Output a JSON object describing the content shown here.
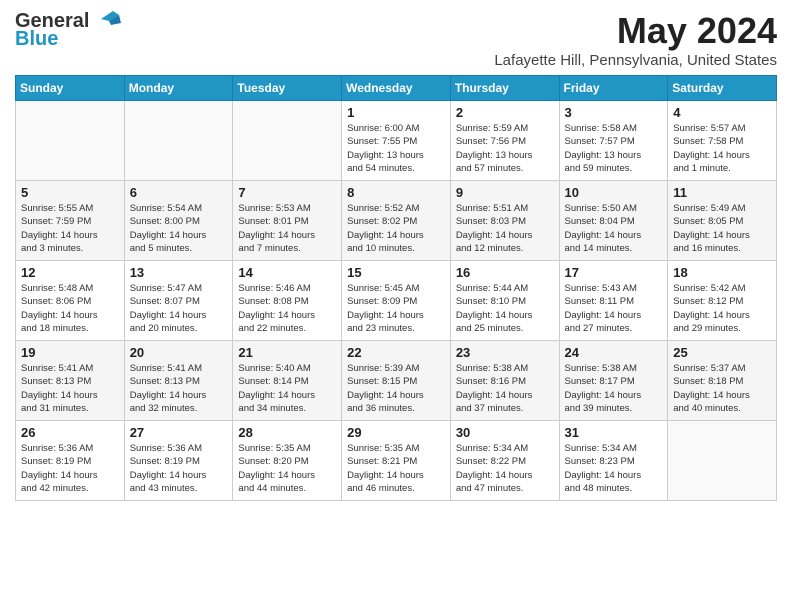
{
  "logo": {
    "text1": "General",
    "text2": "Blue"
  },
  "header": {
    "month": "May 2024",
    "location": "Lafayette Hill, Pennsylvania, United States"
  },
  "days_of_week": [
    "Sunday",
    "Monday",
    "Tuesday",
    "Wednesday",
    "Thursday",
    "Friday",
    "Saturday"
  ],
  "weeks": [
    [
      {
        "day": "",
        "info": ""
      },
      {
        "day": "",
        "info": ""
      },
      {
        "day": "",
        "info": ""
      },
      {
        "day": "1",
        "info": "Sunrise: 6:00 AM\nSunset: 7:55 PM\nDaylight: 13 hours\nand 54 minutes."
      },
      {
        "day": "2",
        "info": "Sunrise: 5:59 AM\nSunset: 7:56 PM\nDaylight: 13 hours\nand 57 minutes."
      },
      {
        "day": "3",
        "info": "Sunrise: 5:58 AM\nSunset: 7:57 PM\nDaylight: 13 hours\nand 59 minutes."
      },
      {
        "day": "4",
        "info": "Sunrise: 5:57 AM\nSunset: 7:58 PM\nDaylight: 14 hours\nand 1 minute."
      }
    ],
    [
      {
        "day": "5",
        "info": "Sunrise: 5:55 AM\nSunset: 7:59 PM\nDaylight: 14 hours\nand 3 minutes."
      },
      {
        "day": "6",
        "info": "Sunrise: 5:54 AM\nSunset: 8:00 PM\nDaylight: 14 hours\nand 5 minutes."
      },
      {
        "day": "7",
        "info": "Sunrise: 5:53 AM\nSunset: 8:01 PM\nDaylight: 14 hours\nand 7 minutes."
      },
      {
        "day": "8",
        "info": "Sunrise: 5:52 AM\nSunset: 8:02 PM\nDaylight: 14 hours\nand 10 minutes."
      },
      {
        "day": "9",
        "info": "Sunrise: 5:51 AM\nSunset: 8:03 PM\nDaylight: 14 hours\nand 12 minutes."
      },
      {
        "day": "10",
        "info": "Sunrise: 5:50 AM\nSunset: 8:04 PM\nDaylight: 14 hours\nand 14 minutes."
      },
      {
        "day": "11",
        "info": "Sunrise: 5:49 AM\nSunset: 8:05 PM\nDaylight: 14 hours\nand 16 minutes."
      }
    ],
    [
      {
        "day": "12",
        "info": "Sunrise: 5:48 AM\nSunset: 8:06 PM\nDaylight: 14 hours\nand 18 minutes."
      },
      {
        "day": "13",
        "info": "Sunrise: 5:47 AM\nSunset: 8:07 PM\nDaylight: 14 hours\nand 20 minutes."
      },
      {
        "day": "14",
        "info": "Sunrise: 5:46 AM\nSunset: 8:08 PM\nDaylight: 14 hours\nand 22 minutes."
      },
      {
        "day": "15",
        "info": "Sunrise: 5:45 AM\nSunset: 8:09 PM\nDaylight: 14 hours\nand 23 minutes."
      },
      {
        "day": "16",
        "info": "Sunrise: 5:44 AM\nSunset: 8:10 PM\nDaylight: 14 hours\nand 25 minutes."
      },
      {
        "day": "17",
        "info": "Sunrise: 5:43 AM\nSunset: 8:11 PM\nDaylight: 14 hours\nand 27 minutes."
      },
      {
        "day": "18",
        "info": "Sunrise: 5:42 AM\nSunset: 8:12 PM\nDaylight: 14 hours\nand 29 minutes."
      }
    ],
    [
      {
        "day": "19",
        "info": "Sunrise: 5:41 AM\nSunset: 8:13 PM\nDaylight: 14 hours\nand 31 minutes."
      },
      {
        "day": "20",
        "info": "Sunrise: 5:41 AM\nSunset: 8:13 PM\nDaylight: 14 hours\nand 32 minutes."
      },
      {
        "day": "21",
        "info": "Sunrise: 5:40 AM\nSunset: 8:14 PM\nDaylight: 14 hours\nand 34 minutes."
      },
      {
        "day": "22",
        "info": "Sunrise: 5:39 AM\nSunset: 8:15 PM\nDaylight: 14 hours\nand 36 minutes."
      },
      {
        "day": "23",
        "info": "Sunrise: 5:38 AM\nSunset: 8:16 PM\nDaylight: 14 hours\nand 37 minutes."
      },
      {
        "day": "24",
        "info": "Sunrise: 5:38 AM\nSunset: 8:17 PM\nDaylight: 14 hours\nand 39 minutes."
      },
      {
        "day": "25",
        "info": "Sunrise: 5:37 AM\nSunset: 8:18 PM\nDaylight: 14 hours\nand 40 minutes."
      }
    ],
    [
      {
        "day": "26",
        "info": "Sunrise: 5:36 AM\nSunset: 8:19 PM\nDaylight: 14 hours\nand 42 minutes."
      },
      {
        "day": "27",
        "info": "Sunrise: 5:36 AM\nSunset: 8:19 PM\nDaylight: 14 hours\nand 43 minutes."
      },
      {
        "day": "28",
        "info": "Sunrise: 5:35 AM\nSunset: 8:20 PM\nDaylight: 14 hours\nand 44 minutes."
      },
      {
        "day": "29",
        "info": "Sunrise: 5:35 AM\nSunset: 8:21 PM\nDaylight: 14 hours\nand 46 minutes."
      },
      {
        "day": "30",
        "info": "Sunrise: 5:34 AM\nSunset: 8:22 PM\nDaylight: 14 hours\nand 47 minutes."
      },
      {
        "day": "31",
        "info": "Sunrise: 5:34 AM\nSunset: 8:23 PM\nDaylight: 14 hours\nand 48 minutes."
      },
      {
        "day": "",
        "info": ""
      }
    ]
  ]
}
